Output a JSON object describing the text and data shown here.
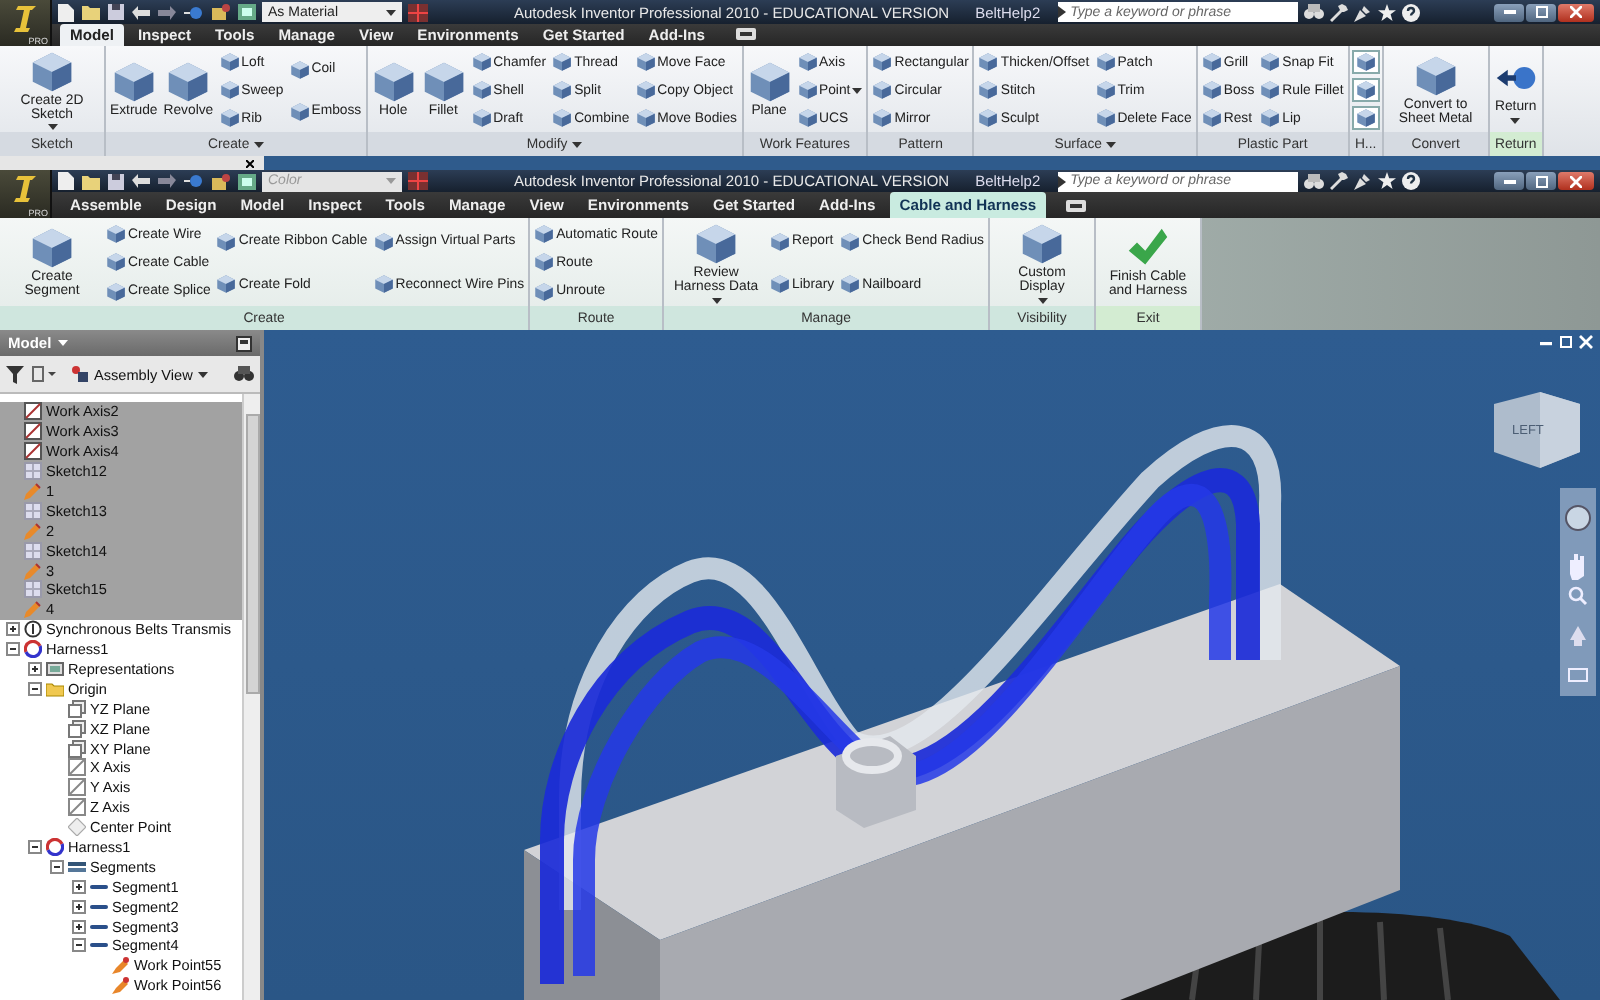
{
  "windows": [
    {
      "app_badge": "PRO",
      "appearance": {
        "value": "As Material",
        "disabled": false
      },
      "title": "Autodesk Inventor Professional 2010 - EDUCATIONAL VERSION",
      "document": "BeltHelp2",
      "search": {
        "placeholder": "Type a keyword or phrase"
      },
      "tabs": [
        {
          "label": "Model",
          "selected": true,
          "kind": "standard"
        },
        {
          "label": "Inspect",
          "selected": false,
          "kind": "standard"
        },
        {
          "label": "Tools",
          "selected": false,
          "kind": "standard"
        },
        {
          "label": "Manage",
          "selected": false,
          "kind": "standard"
        },
        {
          "label": "View",
          "selected": false,
          "kind": "standard"
        },
        {
          "label": "Environments",
          "selected": false,
          "kind": "standard"
        },
        {
          "label": "Get Started",
          "selected": false,
          "kind": "standard"
        },
        {
          "label": "Add-Ins",
          "selected": false,
          "kind": "standard"
        }
      ],
      "ribbon": {
        "panels": [
          {
            "label": "Sketch",
            "menu": false,
            "kind": "normal",
            "columns": [
              [
                {
                  "label": "Create 2D Sketch",
                  "kind": "large",
                  "menu": true
                }
              ]
            ]
          },
          {
            "label": "Create",
            "menu": true,
            "kind": "normal",
            "columns": [
              [
                {
                  "label": "Extrude",
                  "kind": "large",
                  "menu": false
                }
              ],
              [
                {
                  "label": "Revolve",
                  "kind": "large",
                  "menu": false
                }
              ],
              [
                {
                  "label": "Loft",
                  "kind": "small",
                  "menu": false
                },
                {
                  "label": "Sweep",
                  "kind": "small",
                  "menu": false
                },
                {
                  "label": "Rib",
                  "kind": "small",
                  "menu": false
                }
              ],
              [
                {
                  "label": "Coil",
                  "kind": "small",
                  "menu": false
                },
                {
                  "label": "Emboss",
                  "kind": "small",
                  "menu": false
                }
              ]
            ]
          },
          {
            "label": "Modify",
            "menu": true,
            "kind": "normal",
            "columns": [
              [
                {
                  "label": "Hole",
                  "kind": "large",
                  "menu": false
                }
              ],
              [
                {
                  "label": "Fillet",
                  "kind": "large",
                  "menu": false
                }
              ],
              [
                {
                  "label": "Chamfer",
                  "kind": "small",
                  "menu": false
                },
                {
                  "label": "Shell",
                  "kind": "small",
                  "menu": false
                },
                {
                  "label": "Draft",
                  "kind": "small",
                  "menu": false
                }
              ],
              [
                {
                  "label": "Thread",
                  "kind": "small",
                  "menu": false
                },
                {
                  "label": "Split",
                  "kind": "small",
                  "menu": false
                },
                {
                  "label": "Combine",
                  "kind": "small",
                  "menu": false
                }
              ],
              [
                {
                  "label": "Move Face",
                  "kind": "small",
                  "menu": false
                },
                {
                  "label": "Copy Object",
                  "kind": "small",
                  "menu": false
                },
                {
                  "label": "Move Bodies",
                  "kind": "small",
                  "menu": false
                }
              ]
            ]
          },
          {
            "label": "Work Features",
            "menu": false,
            "kind": "normal",
            "columns": [
              [
                {
                  "label": "Plane",
                  "kind": "large",
                  "menu": false
                }
              ],
              [
                {
                  "label": "Axis",
                  "kind": "small",
                  "menu": false
                },
                {
                  "label": "Point",
                  "kind": "small",
                  "menu": true
                },
                {
                  "label": "UCS",
                  "kind": "small",
                  "menu": false
                }
              ]
            ]
          },
          {
            "label": "Pattern",
            "menu": false,
            "kind": "normal",
            "columns": [
              [
                {
                  "label": "Rectangular",
                  "kind": "small",
                  "menu": false
                },
                {
                  "label": "Circular",
                  "kind": "small",
                  "menu": false
                },
                {
                  "label": "Mirror",
                  "kind": "small",
                  "menu": false
                }
              ]
            ]
          },
          {
            "label": "Surface",
            "menu": true,
            "kind": "normal",
            "columns": [
              [
                {
                  "label": "Thicken/Offset",
                  "kind": "small",
                  "menu": false
                },
                {
                  "label": "Stitch",
                  "kind": "small",
                  "menu": false
                },
                {
                  "label": "Sculpt",
                  "kind": "small",
                  "menu": false
                }
              ],
              [
                {
                  "label": "Patch",
                  "kind": "small",
                  "menu": false
                },
                {
                  "label": "Trim",
                  "kind": "small",
                  "menu": false
                },
                {
                  "label": "Delete Face",
                  "kind": "small",
                  "menu": false
                }
              ]
            ]
          },
          {
            "label": "Plastic Part",
            "menu": false,
            "kind": "normal",
            "columns": [
              [
                {
                  "label": "Grill",
                  "kind": "small",
                  "menu": false
                },
                {
                  "label": "Boss",
                  "kind": "small",
                  "menu": false
                },
                {
                  "label": "Rest",
                  "kind": "small",
                  "menu": false
                }
              ],
              [
                {
                  "label": "Snap Fit",
                  "kind": "small",
                  "menu": false
                },
                {
                  "label": "Rule Fillet",
                  "kind": "small",
                  "menu": false
                },
                {
                  "label": "Lip",
                  "kind": "small",
                  "menu": false
                }
              ]
            ]
          },
          {
            "label": "H...",
            "menu": false,
            "kind": "normal",
            "columns": [
              [
                {
                  "kind": "icon",
                  "menu": false
                },
                {
                  "kind": "icon",
                  "menu": false
                },
                {
                  "kind": "icon",
                  "menu": false
                }
              ]
            ]
          },
          {
            "label": "Convert",
            "menu": false,
            "kind": "normal",
            "columns": [
              [
                {
                  "label": "Convert to Sheet Metal",
                  "kind": "large",
                  "menu": false
                }
              ]
            ]
          },
          {
            "label": "Return",
            "menu": false,
            "kind": "exit",
            "columns": [
              [
                {
                  "label": "Return",
                  "kind": "large",
                  "menu": true
                }
              ]
            ]
          }
        ]
      }
    },
    {
      "app_badge": "PRO",
      "appearance": {
        "value": "Color",
        "disabled": true
      },
      "title": "Autodesk Inventor Professional 2010 - EDUCATIONAL VERSION",
      "document": "BeltHelp2",
      "search": {
        "placeholder": "Type a keyword or phrase"
      },
      "tabs": [
        {
          "label": "Assemble",
          "selected": false,
          "kind": "standard"
        },
        {
          "label": "Design",
          "selected": false,
          "kind": "standard"
        },
        {
          "label": "Model",
          "selected": false,
          "kind": "standard"
        },
        {
          "label": "Inspect",
          "selected": false,
          "kind": "standard"
        },
        {
          "label": "Tools",
          "selected": false,
          "kind": "standard"
        },
        {
          "label": "Manage",
          "selected": false,
          "kind": "standard"
        },
        {
          "label": "View",
          "selected": false,
          "kind": "standard"
        },
        {
          "label": "Environments",
          "selected": false,
          "kind": "standard"
        },
        {
          "label": "Get Started",
          "selected": false,
          "kind": "standard"
        },
        {
          "label": "Add-Ins",
          "selected": false,
          "kind": "standard"
        },
        {
          "label": "Cable and Harness",
          "selected": true,
          "kind": "contextual"
        }
      ],
      "ribbon": {
        "panels": [
          {
            "label": "Create",
            "menu": false,
            "kind": "normal",
            "columns": [
              [
                {
                  "label": "Create Segment",
                  "kind": "large",
                  "menu": false
                }
              ],
              [
                {
                  "label": "Create Wire",
                  "kind": "small",
                  "menu": false
                },
                {
                  "label": "Create Cable",
                  "kind": "small",
                  "menu": false
                },
                {
                  "label": "Create Splice",
                  "kind": "small",
                  "menu": false
                }
              ],
              [
                {
                  "label": "Create Ribbon Cable",
                  "kind": "small",
                  "menu": false
                },
                {
                  "label": "Create Fold",
                  "kind": "small",
                  "menu": false
                }
              ],
              [
                {
                  "label": "Assign Virtual Parts",
                  "kind": "small",
                  "menu": false
                },
                {
                  "label": "Reconnect Wire Pins",
                  "kind": "small",
                  "menu": false
                }
              ]
            ]
          },
          {
            "label": "Route",
            "menu": false,
            "kind": "normal",
            "columns": [
              [
                {
                  "label": "Automatic Route",
                  "kind": "small",
                  "menu": false
                },
                {
                  "label": "Route",
                  "kind": "small",
                  "menu": false
                },
                {
                  "label": "Unroute",
                  "kind": "small",
                  "menu": false
                }
              ]
            ]
          },
          {
            "label": "Manage",
            "menu": false,
            "kind": "normal",
            "columns": [
              [
                {
                  "label": "Review Harness Data",
                  "kind": "large",
                  "menu": true
                }
              ],
              [
                {
                  "label": "Report",
                  "kind": "small",
                  "menu": false
                },
                {
                  "label": "Library",
                  "kind": "small",
                  "menu": false
                }
              ],
              [
                {
                  "label": "Check Bend Radius",
                  "kind": "small",
                  "menu": false
                },
                {
                  "label": "Nailboard",
                  "kind": "small",
                  "menu": false
                }
              ]
            ]
          },
          {
            "label": "Visibility",
            "menu": false,
            "kind": "normal",
            "columns": [
              [
                {
                  "label": "Custom Display",
                  "kind": "large",
                  "menu": true
                }
              ]
            ]
          },
          {
            "label": "Exit",
            "menu": false,
            "kind": "exit",
            "columns": [
              [
                {
                  "label": "Finish Cable and Harness",
                  "kind": "large",
                  "menu": false
                }
              ]
            ]
          }
        ]
      }
    }
  ],
  "browser": {
    "title": "Model",
    "view": "Assembly View",
    "tree": [
      {
        "label": "Work Axis2",
        "kind": "work_axis",
        "selected": true
      },
      {
        "label": "Work Axis3",
        "kind": "work_axis",
        "selected": true
      },
      {
        "label": "Work Axis4",
        "kind": "work_axis",
        "selected": true
      },
      {
        "label": "Sketch12",
        "kind": "sketch",
        "selected": true
      },
      {
        "label": "1",
        "kind": "feature",
        "selected": true
      },
      {
        "label": "Sketch13",
        "kind": "sketch",
        "selected": true
      },
      {
        "label": "2",
        "kind": "feature",
        "selected": true
      },
      {
        "label": "Sketch14",
        "kind": "sketch",
        "selected": true
      },
      {
        "label": "3",
        "kind": "feature",
        "selected": true
      },
      {
        "label": "Sketch15",
        "kind": "sketch",
        "selected": true
      },
      {
        "label": "4",
        "kind": "feature",
        "selected": true
      },
      {
        "label": "Synchronous Belts Transmis",
        "kind": "component",
        "selected": false,
        "expanded": false
      },
      {
        "label": "Harness1",
        "kind": "assembly",
        "selected": false,
        "expanded": true,
        "children": [
          {
            "label": "Representations",
            "kind": "representations",
            "selected": false,
            "expanded": false
          },
          {
            "label": "Origin",
            "kind": "folder",
            "selected": false,
            "expanded": true,
            "children": [
              {
                "label": "YZ Plane",
                "kind": "plane",
                "selected": false
              },
              {
                "label": "XZ Plane",
                "kind": "plane",
                "selected": false
              },
              {
                "label": "XY Plane",
                "kind": "plane",
                "selected": false
              },
              {
                "label": "X Axis",
                "kind": "axis",
                "selected": false
              },
              {
                "label": "Y Axis",
                "kind": "axis",
                "selected": false
              },
              {
                "label": "Z Axis",
                "kind": "axis",
                "selected": false
              },
              {
                "label": "Center Point",
                "kind": "point",
                "selected": false
              }
            ]
          },
          {
            "label": "Harness1",
            "kind": "assembly",
            "selected": false,
            "expanded": true,
            "children": [
              {
                "label": "Segments",
                "kind": "segments",
                "selected": false,
                "expanded": true,
                "children": [
                  {
                    "label": "Segment1",
                    "kind": "segment",
                    "selected": false,
                    "expanded": false
                  },
                  {
                    "label": "Segment2",
                    "kind": "segment",
                    "selected": false,
                    "expanded": false
                  },
                  {
                    "label": "Segment3",
                    "kind": "segment",
                    "selected": false,
                    "expanded": false
                  },
                  {
                    "label": "Segment4",
                    "kind": "segment",
                    "selected": false,
                    "expanded": true,
                    "children": [
                      {
                        "label": "Work Point55",
                        "kind": "work_point",
                        "selected": false
                      },
                      {
                        "label": "Work Point56",
                        "kind": "work_point",
                        "selected": false
                      }
                    ]
                  }
                ]
              }
            ]
          }
        ]
      }
    ]
  },
  "viewport": {
    "view_cube_label": "LEFT"
  }
}
